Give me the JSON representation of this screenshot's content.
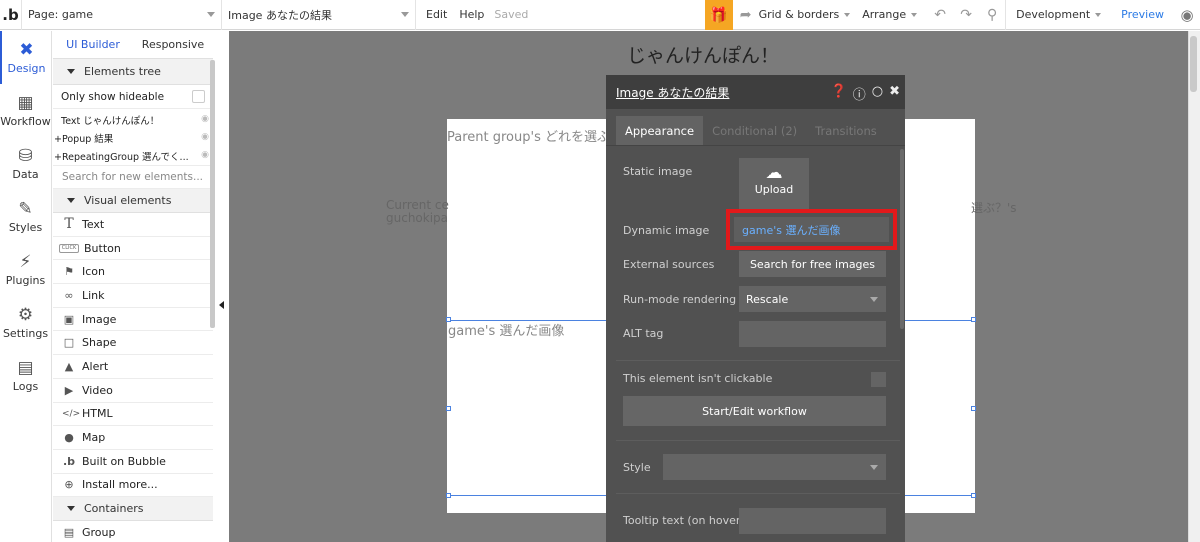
{
  "topbar": {
    "logo": ".b",
    "page_select": "Page: game",
    "element_select": "Image あなたの結果",
    "edit": "Edit",
    "help": "Help",
    "saved": "Saved",
    "grid_borders": "Grid & borders",
    "arrange": "Arrange",
    "development": "Development",
    "preview": "Preview"
  },
  "rail": {
    "items": [
      {
        "label": "Design",
        "icon": "design-icon"
      },
      {
        "label": "Workflow",
        "icon": "workflow-icon"
      },
      {
        "label": "Data",
        "icon": "data-icon"
      },
      {
        "label": "Styles",
        "icon": "styles-icon"
      },
      {
        "label": "Plugins",
        "icon": "plugins-icon"
      },
      {
        "label": "Settings",
        "icon": "settings-icon"
      },
      {
        "label": "Logs",
        "icon": "logs-icon"
      }
    ]
  },
  "left_panel": {
    "tabs": [
      "UI Builder",
      "Responsive"
    ],
    "elements_tree": "Elements tree",
    "only_hideable": "Only show hideable",
    "tree": [
      "Text じゃんけんぽん！",
      "+Popup 結果",
      "+RepeatingGroup 選んでく..."
    ],
    "search_placeholder": "Search for new elements...",
    "visual_elements": "Visual elements",
    "elements": [
      {
        "label": "Text",
        "icon": "text-icon"
      },
      {
        "label": "Button",
        "icon": "button-icon"
      },
      {
        "label": "Icon",
        "icon": "icon-icon"
      },
      {
        "label": "Link",
        "icon": "link-icon"
      },
      {
        "label": "Image",
        "icon": "image-icon"
      },
      {
        "label": "Shape",
        "icon": "shape-icon"
      },
      {
        "label": "Alert",
        "icon": "alert-icon"
      },
      {
        "label": "Video",
        "icon": "video-icon"
      },
      {
        "label": "HTML",
        "icon": "html-icon"
      },
      {
        "label": "Map",
        "icon": "map-icon"
      },
      {
        "label": "Built on Bubble",
        "icon": "bubble-icon"
      },
      {
        "label": "Install more...",
        "icon": "plus-icon"
      }
    ],
    "containers": "Containers",
    "containers_items": [
      {
        "label": "Group",
        "icon": "folder-icon"
      }
    ]
  },
  "canvas": {
    "page_title": "じゃんけんぽん！",
    "parent_group_text": "Parent group's どれを選ぶ",
    "current_cell_text_1": "Current ce",
    "current_cell_text_2": "guchokipa",
    "right_text": "選ぶ？'s",
    "image_label": "game's 選んだ画像"
  },
  "property_editor": {
    "title": "Image あなたの結果",
    "tabs": [
      "Appearance",
      "Conditional (2)",
      "Transitions"
    ],
    "static_image_label": "Static image",
    "upload": "Upload",
    "dynamic_image_label": "Dynamic image",
    "dynamic_image_value": "game's 選んだ画像",
    "external_sources_label": "External sources",
    "search_free_images": "Search for free images",
    "run_mode_label": "Run-mode rendering",
    "run_mode_value": "Rescale",
    "alt_tag_label": "ALT tag",
    "not_clickable_label": "This element isn't clickable",
    "start_edit_workflow": "Start/Edit workflow",
    "style_label": "Style",
    "tooltip_label": "Tooltip text (on hover)"
  },
  "colors": {
    "accent_blue": "#2c5cd6",
    "highlight_red": "#e2191b",
    "gift_orange": "#f5a623",
    "editor_bg": "#515151"
  }
}
